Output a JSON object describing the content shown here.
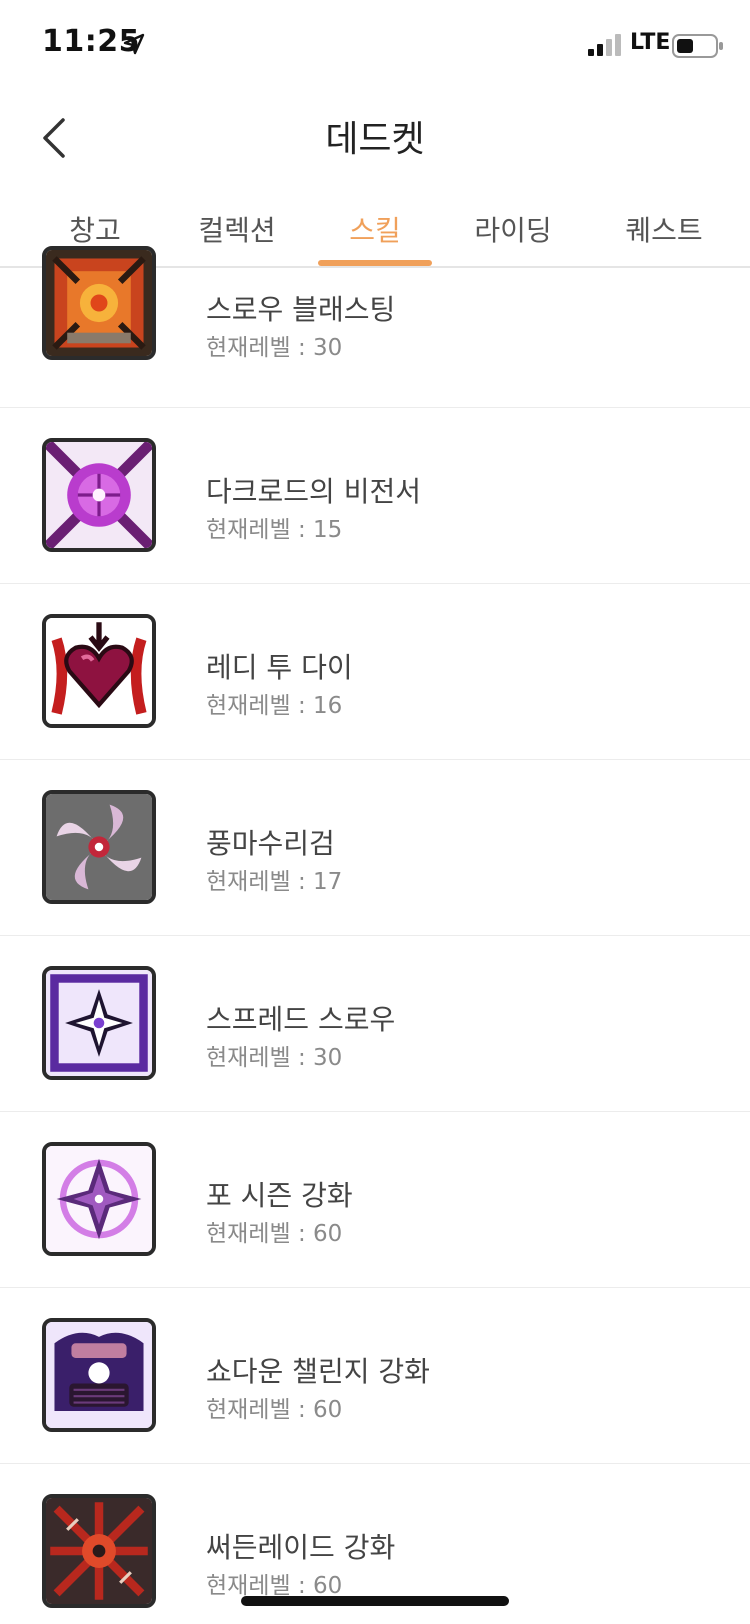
{
  "status_bar": {
    "time": "11:25",
    "network": "LTE",
    "icons": [
      "location-arrow-icon",
      "signal-icon",
      "battery-icon"
    ]
  },
  "nav": {
    "title": "데드켓",
    "back_icon": "chevron-left-icon"
  },
  "tabs": [
    {
      "label": "창고",
      "active": false
    },
    {
      "label": "컬렉션",
      "active": false
    },
    {
      "label": "스킬",
      "active": true
    },
    {
      "label": "라이딩",
      "active": false
    },
    {
      "label": "퀘스트",
      "active": false
    }
  ],
  "colors": {
    "accent": "#f0a05a",
    "text_primary": "#444444",
    "text_secondary": "#8a8a8a",
    "divider": "#ececec"
  },
  "skills": [
    {
      "name": "스로우 블래스팅",
      "level_text": "현재레벨 : 30",
      "icon": "throw-blasting-icon"
    },
    {
      "name": "다크로드의 비전서",
      "level_text": "현재레벨 : 15",
      "icon": "darklord-secret-icon"
    },
    {
      "name": "레디 투 다이",
      "level_text": "현재레벨 : 16",
      "icon": "ready-to-die-icon"
    },
    {
      "name": "풍마수리검",
      "level_text": "현재레벨 : 17",
      "icon": "windmill-shuriken-icon"
    },
    {
      "name": "스프레드 스로우",
      "level_text": "현재레벨 : 30",
      "icon": "spread-throw-icon"
    },
    {
      "name": "포 시즌 강화",
      "level_text": "현재레벨 : 60",
      "icon": "four-seasons-icon"
    },
    {
      "name": "쇼다운 챌린지 강화",
      "level_text": "현재레벨 : 60",
      "icon": "showdown-challenge-icon"
    },
    {
      "name": "써든레이드 강화",
      "level_text": "현재레벨 : 60",
      "icon": "sudden-raid-icon"
    }
  ]
}
